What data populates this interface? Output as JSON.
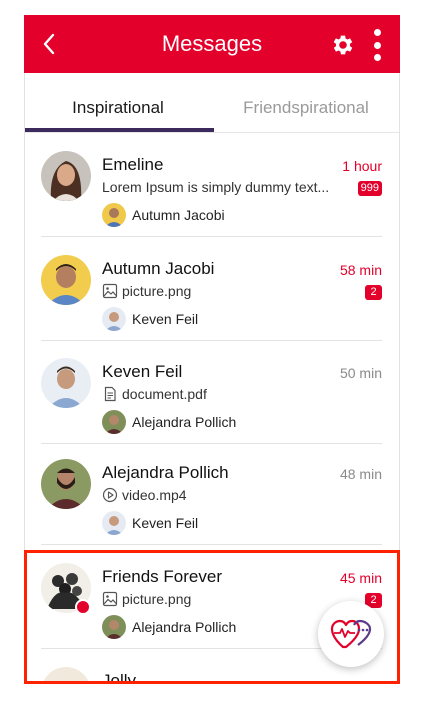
{
  "app": {
    "title": "Messages",
    "back_icon": "chevron-left-icon",
    "settings_icon": "gear-icon",
    "more_icon": "more-vertical-icon",
    "accent": "#e3002b",
    "tab_indicator_color": "#3d2a5c"
  },
  "tabs": [
    {
      "label": "Inspirational",
      "active": true
    },
    {
      "label": "Friendspirational",
      "active": false
    }
  ],
  "conversations": [
    {
      "name": "Emeline",
      "time": "1 hour",
      "time_style": "red",
      "preview": "Lorem Ipsum is simply dummy text...",
      "preview_icon": "",
      "badge": "999",
      "sender": "Autumn Jacobi"
    },
    {
      "name": "Autumn Jacobi",
      "time": "58 min",
      "time_style": "red",
      "preview": "picture.png",
      "preview_icon": "image-icon",
      "badge": "2",
      "sender": "Keven Feil"
    },
    {
      "name": "Keven Feil",
      "time": "50 min",
      "time_style": "grey",
      "preview": "document.pdf",
      "preview_icon": "document-icon",
      "badge": "",
      "sender": "Alejandra Pollich"
    },
    {
      "name": "Alejandra Pollich",
      "time": "48 min",
      "time_style": "grey",
      "preview": "video.mp4",
      "preview_icon": "play-circle-icon",
      "badge": "",
      "sender": "Keven Feil"
    },
    {
      "name": "Friends Forever",
      "time": "45 min",
      "time_style": "red",
      "preview": "picture.png",
      "preview_icon": "image-icon",
      "badge": "2",
      "sender": "Alejandra Pollich"
    },
    {
      "name": "Jolly",
      "time": "",
      "time_style": "grey",
      "preview": "",
      "preview_icon": "",
      "badge": "",
      "sender": ""
    }
  ],
  "fab": {
    "icon": "hearts-chat-icon"
  }
}
